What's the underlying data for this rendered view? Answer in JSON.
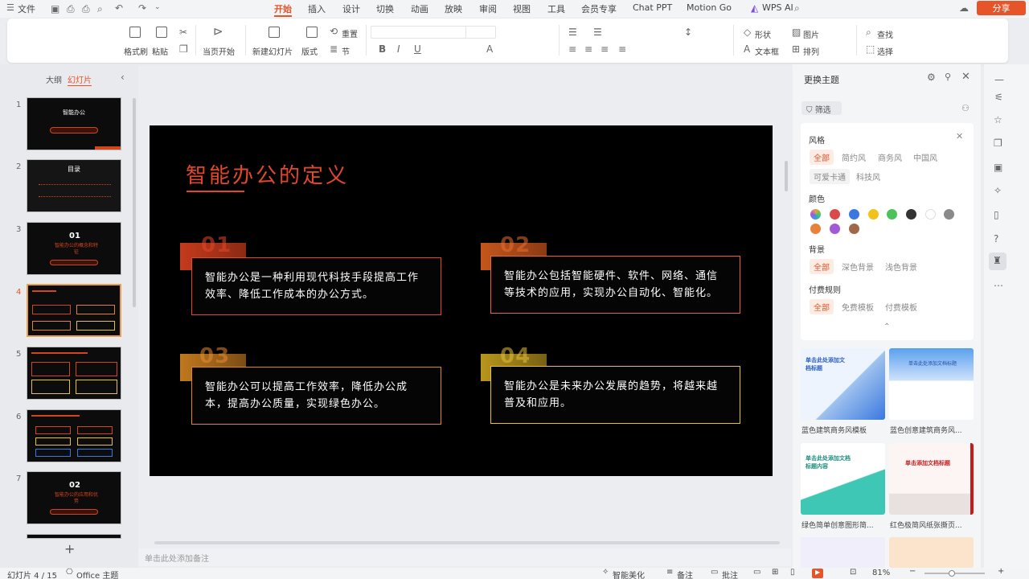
{
  "menu": {
    "file": "文件",
    "tabs": [
      "开始",
      "插入",
      "设计",
      "切换",
      "动画",
      "放映",
      "审阅",
      "视图",
      "工具",
      "会员专享",
      "Chat PPT",
      "Motion Go"
    ],
    "wps_ai": "WPS AI",
    "share": "分享"
  },
  "ribbon": {
    "format_painter": "格式刷",
    "paste": "粘贴",
    "from_current": "当页开始",
    "new_slide": "新建幻灯片",
    "layout": "版式",
    "section": "节",
    "reset": "重置",
    "shape": "形状",
    "picture": "图片",
    "find": "查找",
    "textbox": "文本框",
    "arrange": "排列",
    "select": "选择"
  },
  "left_panel": {
    "tab_outline": "大纲",
    "tab_slides": "幻灯片",
    "slide_numbers": [
      "1",
      "2",
      "3",
      "4",
      "5",
      "6",
      "7"
    ],
    "add_label": "+"
  },
  "slides": {
    "s1_title": "智能办公",
    "s2_title": "目录",
    "s3_num": "01",
    "s3_title": "智能办公的概念和特征",
    "s7_num": "02",
    "s7_title": "智能办公的应用和优势"
  },
  "main_slide": {
    "title": "智能办公的定义",
    "cards": [
      {
        "num": "01",
        "text": "智能办公是一种利用现代科技手段提高工作效率、降低工作成本的办公方式。"
      },
      {
        "num": "02",
        "text": "智能办公包括智能硬件、软件、网络、通信等技术的应用，实现办公自动化、智能化。"
      },
      {
        "num": "03",
        "text": "智能办公可以提高工作效率，降低办公成本，提高办公质量，实现绿色办公。"
      },
      {
        "num": "04",
        "text": "智能办公是未来办公发展的趋势，将越来越普及和应用。"
      }
    ]
  },
  "note_placeholder": "单击此处添加备注",
  "theme_panel": {
    "title": "更换主题",
    "filter": "筛选",
    "style_label": "风格",
    "styles": [
      "全部",
      "简约风",
      "商务风",
      "中国风",
      "可爱卡通",
      "科技风"
    ],
    "color_label": "颜色",
    "colors": [
      "#d94a4a",
      "#3a78e0",
      "#f2c21a",
      "#4cc35a",
      "#333333",
      "#ffffff",
      "#8a8a8a",
      "#e8813a",
      "#a05ad6",
      "#a0674a"
    ],
    "bg_label": "背景",
    "bgs": [
      "全部",
      "深色背景",
      "浅色背景"
    ],
    "pay_label": "付费规则",
    "pays": [
      "全部",
      "免费模板",
      "付费模板"
    ],
    "templates": [
      "蓝色建筑商务风模板",
      "蓝色创意建筑商务风...",
      "绿色简单创意图形简...",
      "红色极简风纸张撕页..."
    ],
    "tpl_text": [
      "单击此处添加文档标题",
      "单击此处添加文档标题",
      "单击此处添加文档标题内容",
      "单击添加文档标题"
    ]
  },
  "status": {
    "slide_count": "幻灯片 4 / 15",
    "theme": "Office 主题",
    "beautify": "智能美化",
    "notes": "备注",
    "comment": "批注",
    "zoom": "81%"
  }
}
